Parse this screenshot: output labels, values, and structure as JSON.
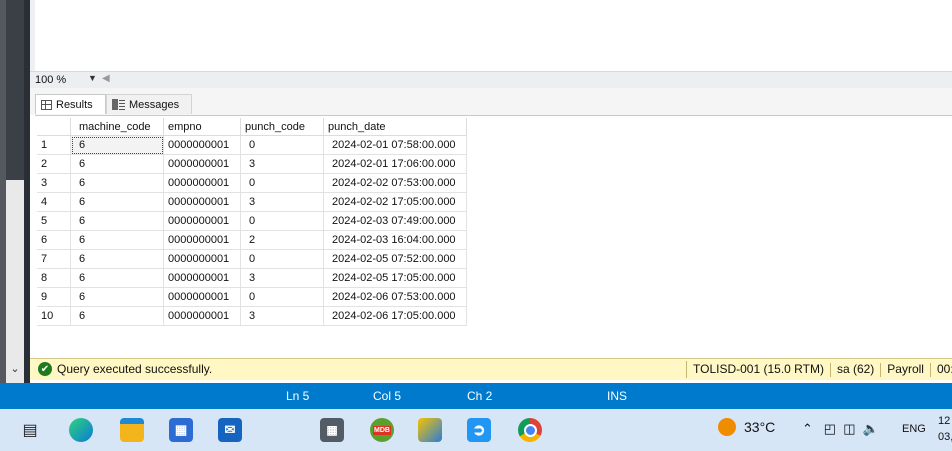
{
  "zoom": {
    "value": "100 %"
  },
  "tabs": {
    "results": "Results",
    "messages": "Messages"
  },
  "grid": {
    "columns": [
      "machine_code",
      "empno",
      "punch_code",
      "punch_date"
    ],
    "rows": [
      {
        "n": "1",
        "machine_code": "6",
        "empno": "0000000001",
        "punch_code": "0",
        "punch_date": "2024-02-01 07:58:00.000"
      },
      {
        "n": "2",
        "machine_code": "6",
        "empno": "0000000001",
        "punch_code": "3",
        "punch_date": "2024-02-01 17:06:00.000"
      },
      {
        "n": "3",
        "machine_code": "6",
        "empno": "0000000001",
        "punch_code": "0",
        "punch_date": "2024-02-02 07:53:00.000"
      },
      {
        "n": "4",
        "machine_code": "6",
        "empno": "0000000001",
        "punch_code": "3",
        "punch_date": "2024-02-02 17:05:00.000"
      },
      {
        "n": "5",
        "machine_code": "6",
        "empno": "0000000001",
        "punch_code": "0",
        "punch_date": "2024-02-03 07:49:00.000"
      },
      {
        "n": "6",
        "machine_code": "6",
        "empno": "0000000001",
        "punch_code": "2",
        "punch_date": "2024-02-03 16:04:00.000"
      },
      {
        "n": "7",
        "machine_code": "6",
        "empno": "0000000001",
        "punch_code": "0",
        "punch_date": "2024-02-05 07:52:00.000"
      },
      {
        "n": "8",
        "machine_code": "6",
        "empno": "0000000001",
        "punch_code": "3",
        "punch_date": "2024-02-05 17:05:00.000"
      },
      {
        "n": "9",
        "machine_code": "6",
        "empno": "0000000001",
        "punch_code": "0",
        "punch_date": "2024-02-06 07:53:00.000"
      },
      {
        "n": "10",
        "machine_code": "6",
        "empno": "0000000001",
        "punch_code": "3",
        "punch_date": "2024-02-06 17:05:00.000"
      }
    ]
  },
  "status": {
    "message": "Query executed successfully.",
    "server": "TOLISD-001 (15.0 RTM)",
    "user": "sa (62)",
    "database": "Payroll",
    "elapsed": "00:"
  },
  "editor_status": {
    "ln": "Ln 5",
    "col": "Col 5",
    "ch": "Ch 2",
    "mode": "INS"
  },
  "taskbar": {
    "temperature": "33°C",
    "language": "ENG",
    "time": "12",
    "date": "03,"
  },
  "colors": {
    "accent": "#007acc",
    "status_bg": "#fff8c5",
    "success": "#1d7a1d"
  }
}
